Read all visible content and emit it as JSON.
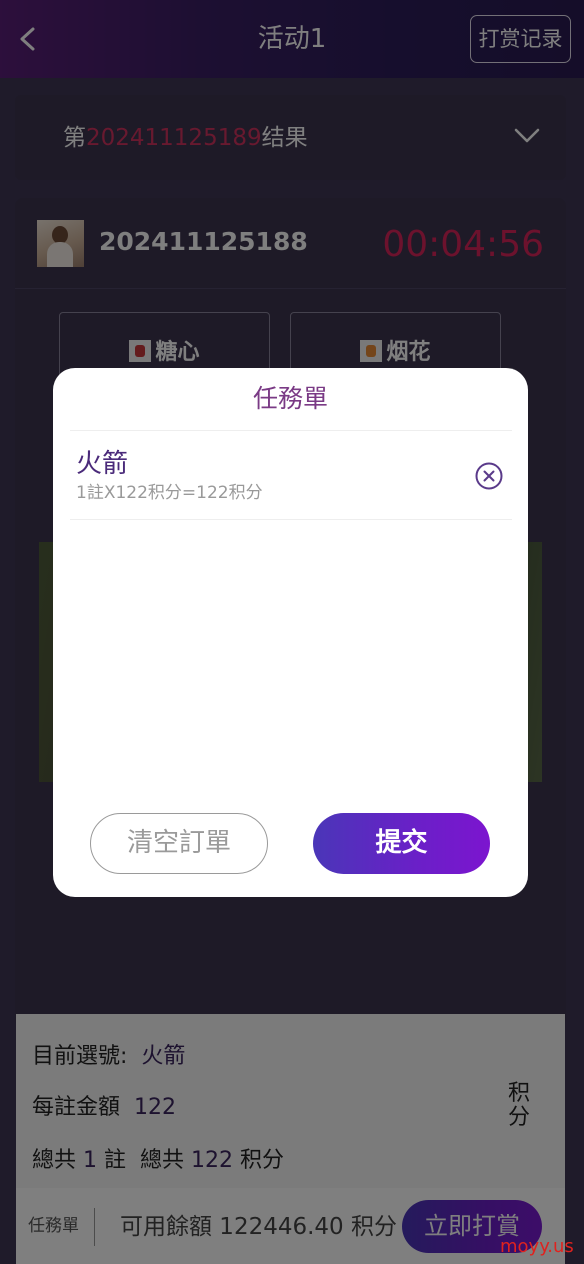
{
  "header": {
    "title": "活动1",
    "records_label": "打赏记录"
  },
  "result": {
    "prefix": "第",
    "number": "202411125189",
    "suffix": "结果"
  },
  "round": {
    "id": "202411125188",
    "countdown": "00:04:56"
  },
  "gifts": [
    {
      "label": "糖心",
      "icon": "candy-icon"
    },
    {
      "label": "烟花",
      "icon": "firework-icon"
    }
  ],
  "order_panel": {
    "selection_label": "目前選號:",
    "selection_value": "火箭",
    "per_bet_label": "每註金額",
    "per_bet_value": "122",
    "total_label_1": "總共",
    "total_count": "1",
    "total_unit": "註",
    "total_label_2": "總共",
    "total_amount": "122",
    "amount_unit": "积分",
    "unit_vertical": "积分"
  },
  "footer": {
    "orders_tab": "任務單",
    "balance_text": "可用餘額 122446.40 积分",
    "tip_button": "立即打賞"
  },
  "modal": {
    "title": "任務單",
    "item_name": "火箭",
    "item_calc": "1註X122积分=122积分",
    "clear_button": "清空訂單",
    "submit_button": "提交"
  },
  "watermark": "moyy.us",
  "colors": {
    "accent_purple": "#6b1fc8",
    "countdown_red": "#d8245a",
    "result_number": "#d0335f"
  }
}
